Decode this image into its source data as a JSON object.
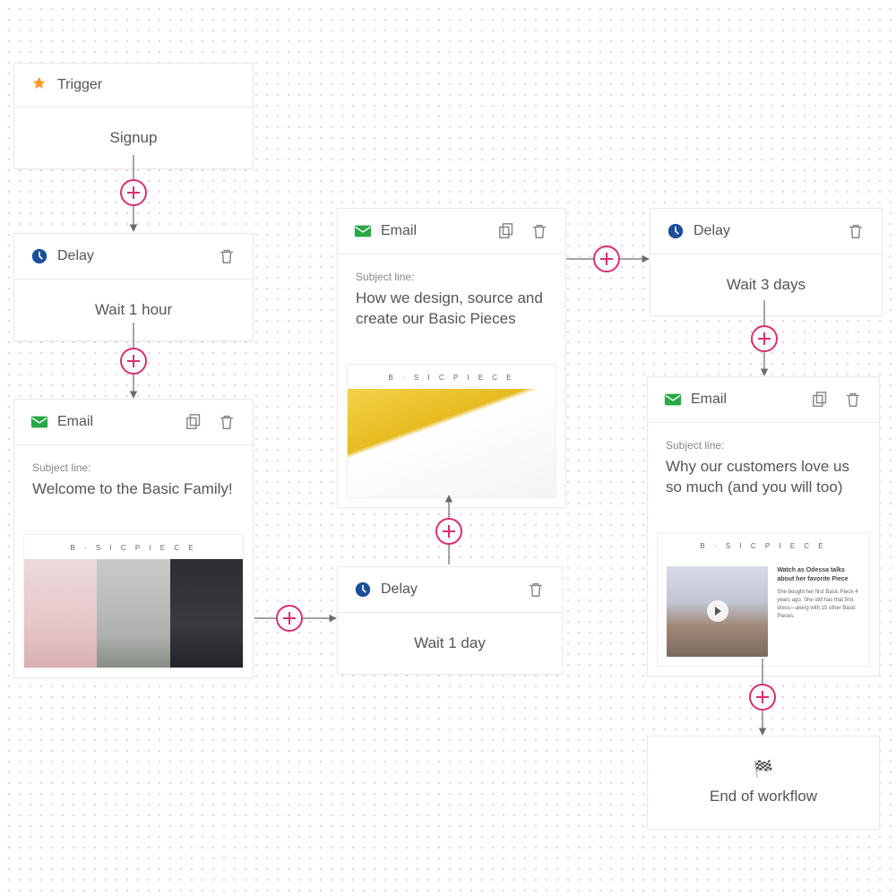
{
  "nodes": {
    "trigger": {
      "type_label": "Trigger",
      "body": "Signup"
    },
    "delay1": {
      "type_label": "Delay",
      "body": "Wait 1 hour"
    },
    "email1": {
      "type_label": "Email",
      "subject_label": "Subject line:",
      "subject": "Welcome to the Basic Family!",
      "preview_brand": "B · S I C   P I E C E"
    },
    "delay2": {
      "type_label": "Delay",
      "body": "Wait 1 day"
    },
    "email2": {
      "type_label": "Email",
      "subject_label": "Subject line:",
      "subject": "How we design, source and create our Basic Pieces",
      "preview_brand": "B · S I C   P I E C E"
    },
    "delay3": {
      "type_label": "Delay",
      "body": "Wait 3 days"
    },
    "email3": {
      "type_label": "Email",
      "subject_label": "Subject line:",
      "subject": "Why our customers love us so much (and you will too)",
      "preview_brand": "B · S I C   P I E C E",
      "preview_headline": "Watch as Odessa talks about her favorite Piece",
      "preview_copy": "She bought her first Basic Piece 4 years ago. She still has that first dress—along with 15 other Basic Pieces."
    },
    "end": {
      "label": "End of workflow"
    }
  },
  "chart_data": {
    "type": "flow",
    "title": "",
    "nodes": [
      {
        "id": "trigger",
        "kind": "trigger",
        "label": "Signup"
      },
      {
        "id": "delay1",
        "kind": "delay",
        "label": "Wait 1 hour"
      },
      {
        "id": "email1",
        "kind": "email",
        "label": "Welcome to the Basic Family!"
      },
      {
        "id": "delay2",
        "kind": "delay",
        "label": "Wait 1 day"
      },
      {
        "id": "email2",
        "kind": "email",
        "label": "How we design, source and create our Basic Pieces"
      },
      {
        "id": "delay3",
        "kind": "delay",
        "label": "Wait 3 days"
      },
      {
        "id": "email3",
        "kind": "email",
        "label": "Why our customers love us so much (and you will too)"
      },
      {
        "id": "end",
        "kind": "end",
        "label": "End of workflow"
      }
    ],
    "edges": [
      [
        "trigger",
        "delay1"
      ],
      [
        "delay1",
        "email1"
      ],
      [
        "email1",
        "delay2"
      ],
      [
        "delay2",
        "email2"
      ],
      [
        "email2",
        "delay3"
      ],
      [
        "delay3",
        "email3"
      ],
      [
        "email3",
        "end"
      ]
    ]
  }
}
